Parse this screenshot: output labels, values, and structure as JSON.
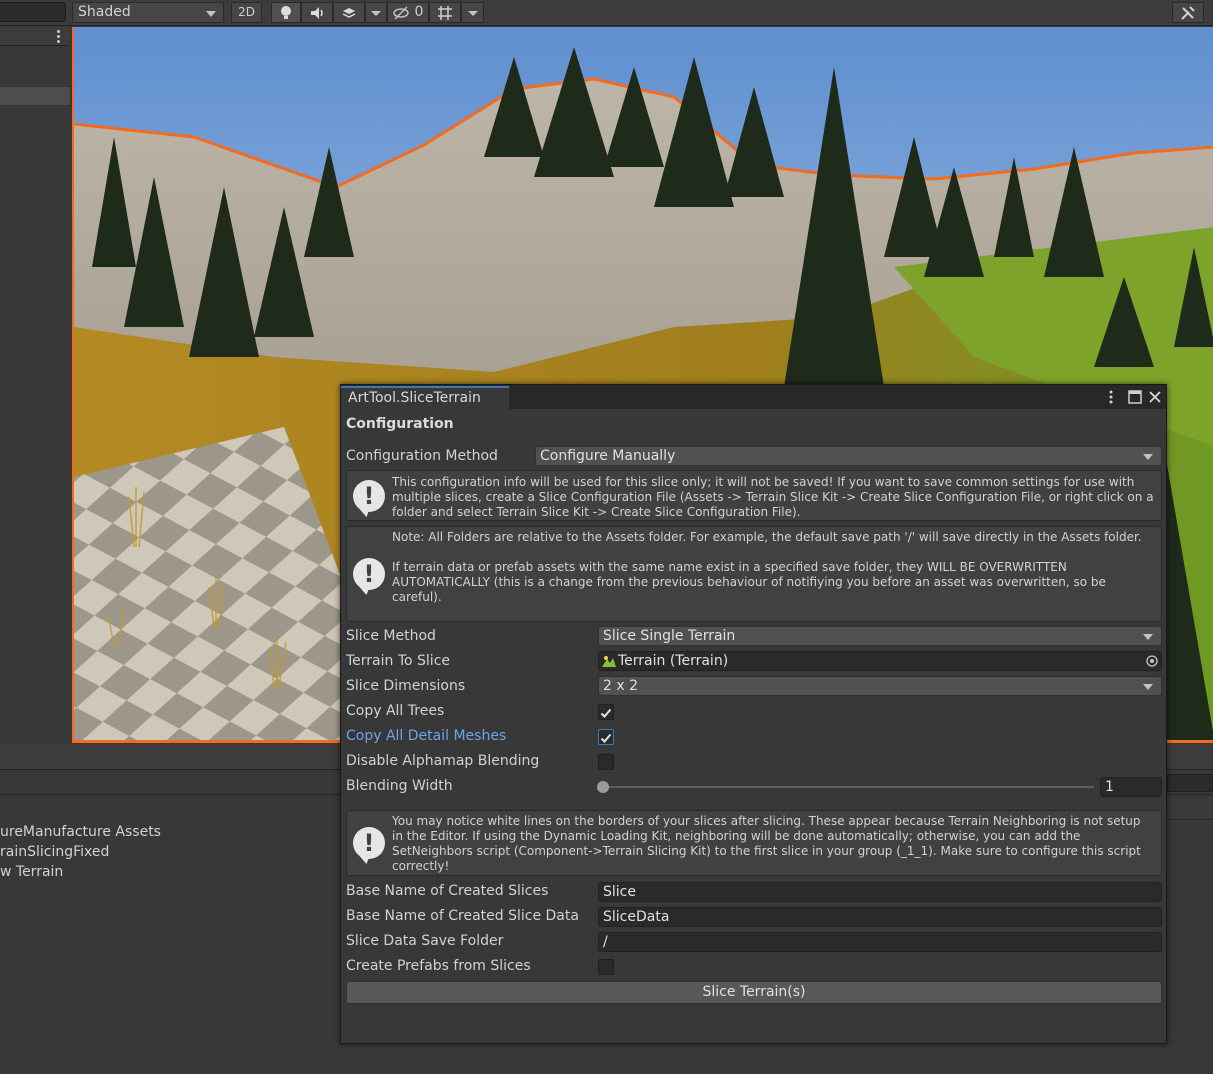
{
  "toolbar": {
    "shading_mode": "Shaded",
    "mode_2d": "2D",
    "hidden_count": "0"
  },
  "project": {
    "items": [
      "ureManufacture Assets",
      "rainSlicingFixed",
      "w Terrain"
    ]
  },
  "window": {
    "tab_title": "ArtTool.SliceTerrain",
    "section_title": "Configuration",
    "config_method_label": "Configuration Method",
    "config_method_value": "Configure Manually",
    "help1": "This configuration info will be used for this slice only; it will not be saved! If you want to save common settings for use with multiple slices, create a Slice Configuration File (Assets -> Terrain Slice Kit -> Create Slice Configuration File, or right click on a folder and select Terrain Slice Kit -> Create Slice Configuration File).",
    "help2": "Note: All Folders are relative to the Assets folder. For example, the default save path '/' will save directly in the Assets folder.\n\nIf terrain data or prefab assets with the same name exist in a specified save folder, they WILL BE OVERWRITTEN AUTOMATICALLY (this is a change from the previous behaviour of notifiying you before an asset was overwritten, so be careful).",
    "slice_method_label": "Slice Method",
    "slice_method_value": "Slice Single Terrain",
    "terrain_to_slice_label": "Terrain To Slice",
    "terrain_to_slice_value": "Terrain (Terrain)",
    "slice_dimensions_label": "Slice Dimensions",
    "slice_dimensions_value": "2 x 2",
    "copy_trees_label": "Copy All Trees",
    "copy_trees_checked": true,
    "copy_detail_label": "Copy All Detail Meshes",
    "copy_detail_checked": true,
    "disable_alpha_label": "Disable Alphamap Blending",
    "disable_alpha_checked": false,
    "blending_width_label": "Blending Width",
    "blending_width_value": "1",
    "help3": "You may notice white lines on the borders of your slices after slicing. These appear because Terrain Neighboring is not setup in the Editor. If using the Dynamic Loading Kit, neighboring will be done automatically; otherwise, you can add the SetNeighbors script (Component->Terrain Slicing Kit) to the first slice in your group (_1_1). Make sure to configure this script correctly!",
    "base_name_label": "Base Name of Created Slices",
    "base_name_value": "Slice",
    "base_data_label": "Base Name of Created Slice Data",
    "base_data_value": "SliceData",
    "save_folder_label": "Slice Data Save Folder",
    "save_folder_value": "/",
    "create_prefabs_label": "Create Prefabs from Slices",
    "create_prefabs_checked": false,
    "slice_button": "Slice Terrain(s)"
  },
  "colors": {
    "accent": "#3a79bb",
    "selection_outline": "#f26b1f",
    "highlight_label": "#6aa5e8"
  }
}
